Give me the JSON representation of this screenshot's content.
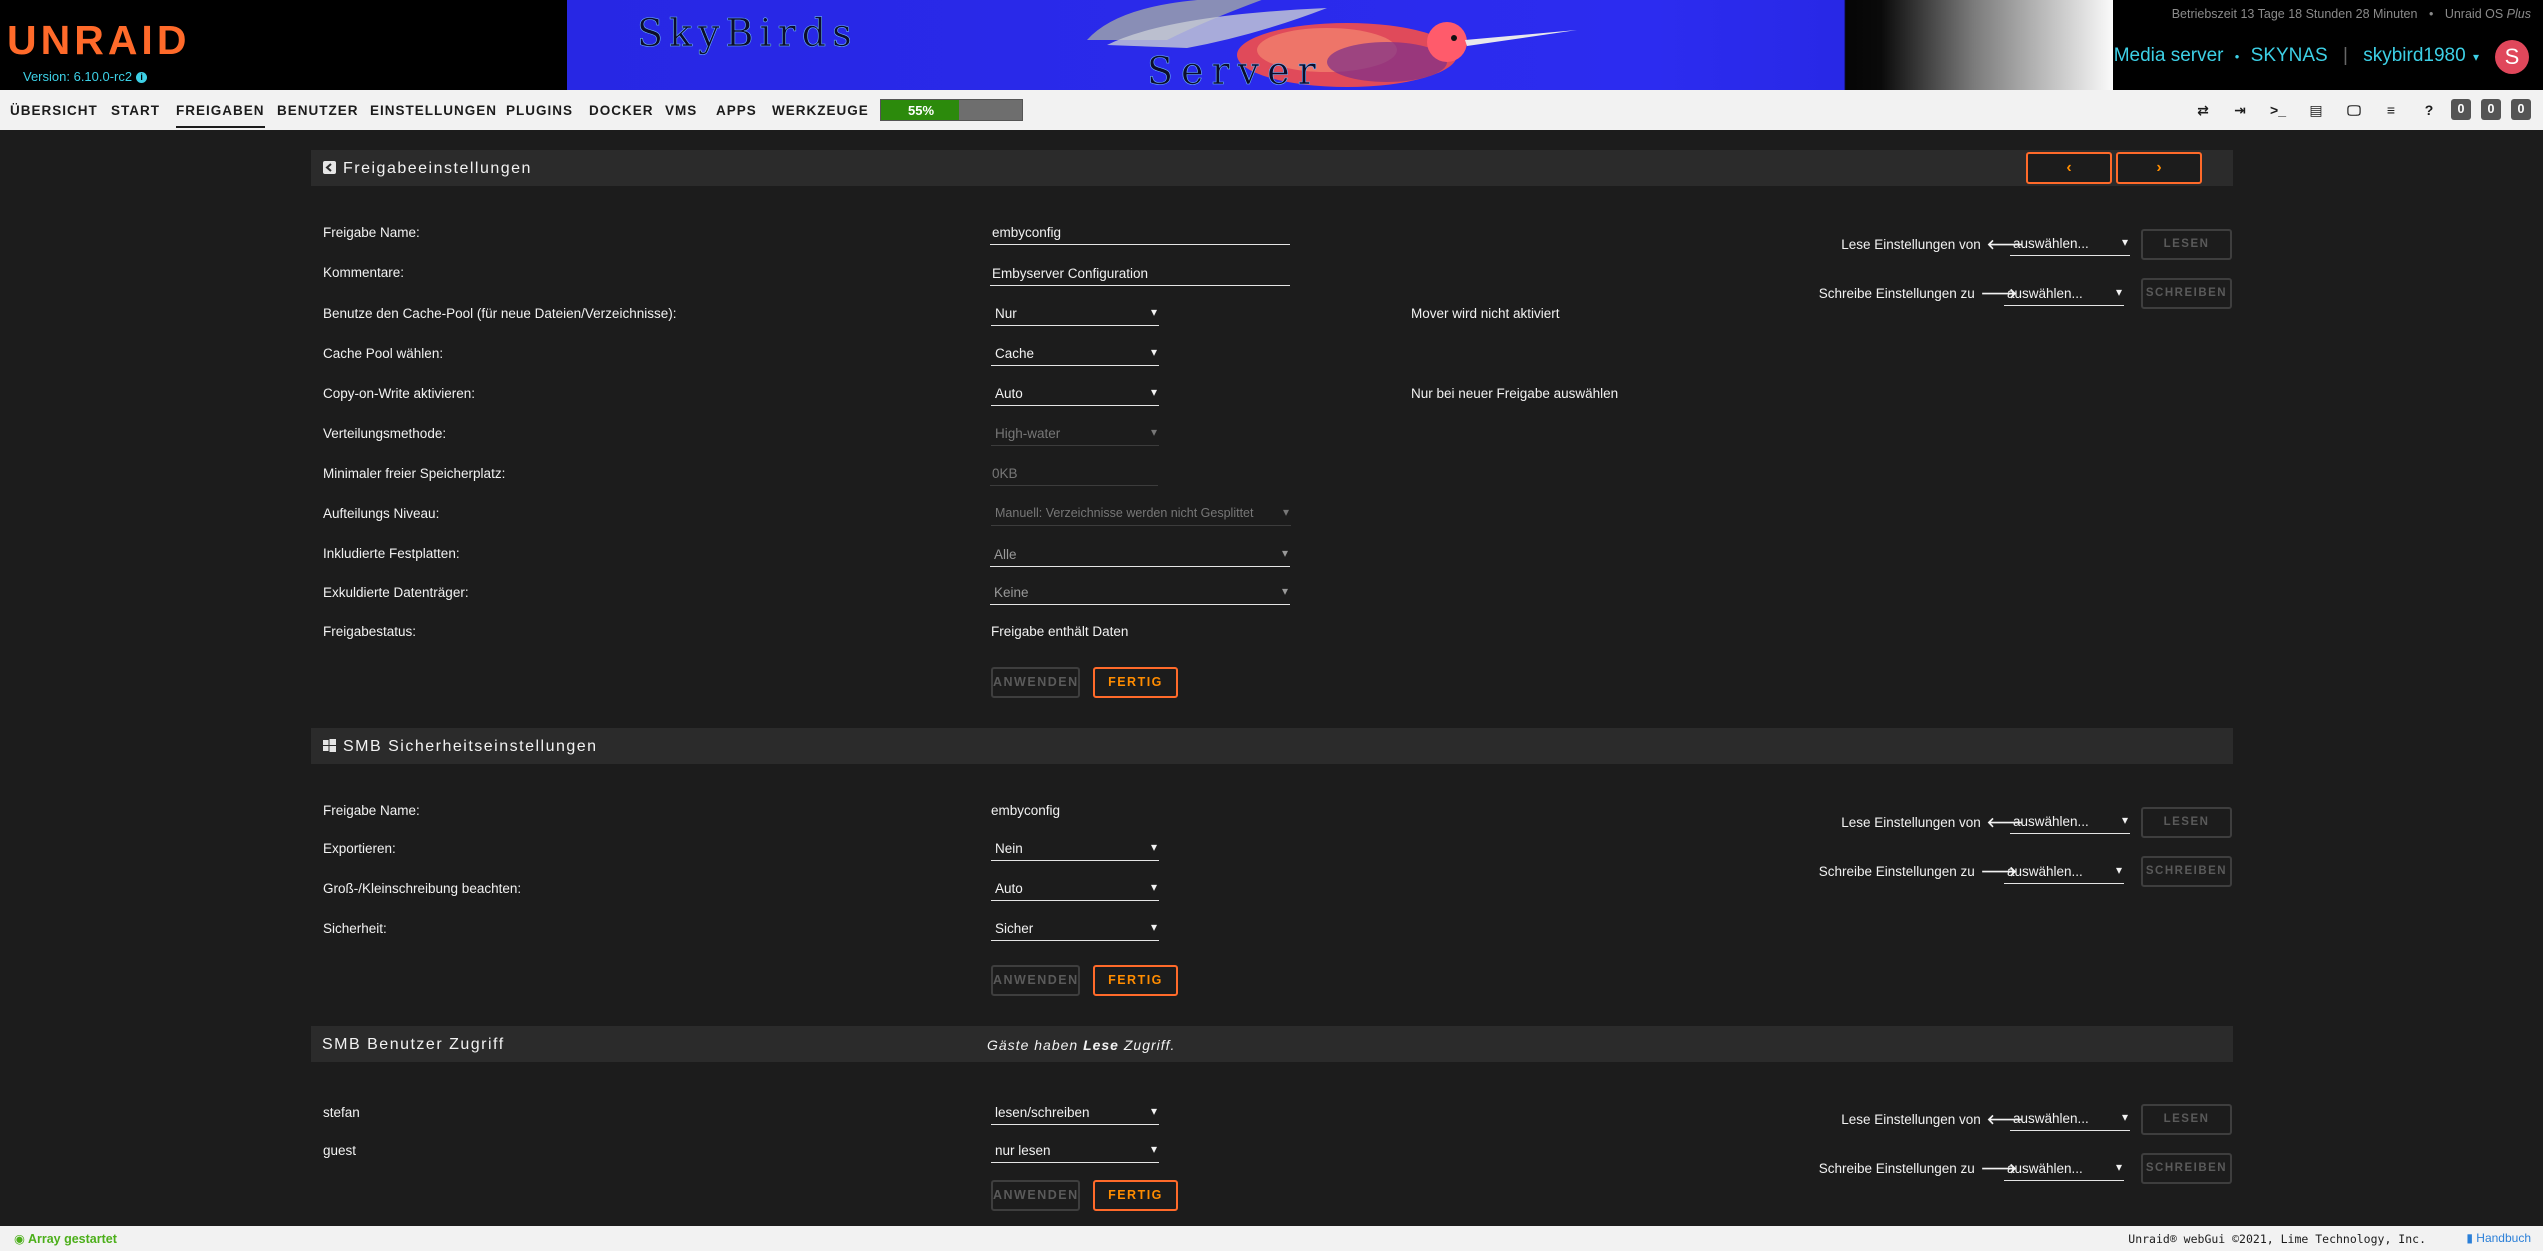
{
  "header": {
    "logo": "UNRAID",
    "version": "Version: 6.10.0-rc2",
    "banner_text_1": "SkyBirds",
    "banner_text_2": "Server",
    "uptime": "Betriebszeit 13 Tage 18 Stunden 28 Minuten",
    "uptime_sep": "•",
    "license_prefix": "Unraid OS",
    "license_tier": "Plus",
    "server_description": "Media server",
    "server_dot": "•",
    "server_name": "SKYNAS",
    "server_sep": "|",
    "username": "skybird1980",
    "user_caret": "▾",
    "avatar_letter": "S"
  },
  "nav": {
    "items": [
      "ÜBERSICHT",
      "START",
      "FREIGABEN",
      "BENUTZER",
      "EINSTELLUNGEN",
      "PLUGINS",
      "DOCKER",
      "VMS",
      "APPS",
      "WERKZEUGE"
    ],
    "active": "FREIGABEN",
    "progress_label": "55%",
    "progress_value": 0.55,
    "badges": [
      "0",
      "0",
      "0"
    ]
  },
  "share_settings": {
    "title": "Freigabeeinstellungen",
    "prev_icon": "‹",
    "next_icon": "›",
    "fields": {
      "name_label": "Freigabe Name:",
      "name_value": "embyconfig",
      "comment_label": "Kommentare:",
      "comment_value": "Embyserver Configuration",
      "cache_label": "Benutze den Cache-Pool (für neue Dateien/Verzeichnisse):",
      "cache_value": "Nur",
      "cache_note": "Mover wird nicht aktiviert",
      "pool_label": "Cache Pool wählen:",
      "pool_value": "Cache",
      "cow_label": "Copy-on-Write aktivieren:",
      "cow_value": "Auto",
      "cow_note": "Nur bei neuer Freigabe auswählen",
      "alloc_label": "Verteilungsmethode:",
      "alloc_value": "High-water",
      "minfree_label": "Minimaler freier Speicherplatz:",
      "minfree_value": "0KB",
      "split_label": "Aufteilungs Niveau:",
      "split_value": "Manuell: Verzeichnisse werden nicht Gesplittet",
      "include_label": "Inkludierte Festplatten:",
      "include_value": "Alle",
      "exclude_label": "Exkuldierte Datenträger:",
      "exclude_value": "Keine",
      "status_label": "Freigabestatus:",
      "status_value": "Freigabe enthält Daten"
    },
    "apply_label": "ANWENDEN",
    "done_label": "FERTIG",
    "read_label": "Lese Einstellungen von",
    "read_arrow": "🡐",
    "read_value": "auswählen...",
    "read_button": "LESEN",
    "write_label": "Schreibe Einstellungen zu",
    "write_arrow": "🡒",
    "write_value": "auswählen...",
    "write_button": "SCHREIBEN"
  },
  "smb_security": {
    "title": "SMB Sicherheitseinstellungen",
    "name_label": "Freigabe Name:",
    "name_value": "embyconfig",
    "export_label": "Exportieren:",
    "export_value": "Nein",
    "case_label": "Groß-/Kleinschreibung beachten:",
    "case_value": "Auto",
    "security_label": "Sicherheit:",
    "security_value": "Sicher",
    "apply_label": "ANWENDEN",
    "done_label": "FERTIG",
    "read_label": "Lese Einstellungen von",
    "read_arrow": "🡐",
    "read_value": "auswählen...",
    "read_button": "LESEN",
    "write_label": "Schreibe Einstellungen zu",
    "write_arrow": "🡒",
    "write_value": "auswählen...",
    "write_button": "SCHREIBEN"
  },
  "smb_users": {
    "title": "SMB Benutzer Zugriff",
    "guest_note_1": "Gäste haben ",
    "guest_note_bold": "Lese",
    "guest_note_2": " Zugriff.",
    "users": [
      {
        "name": "stefan",
        "access": "lesen/schreiben"
      },
      {
        "name": "guest",
        "access": "nur lesen"
      }
    ],
    "apply_label": "ANWENDEN",
    "done_label": "FERTIG",
    "read_label": "Lese Einstellungen von",
    "read_arrow": "🡐",
    "read_value": "auswählen...",
    "read_button": "LESEN",
    "write_label": "Schreibe Einstellungen zu",
    "write_arrow": "🡒",
    "write_value": "auswählen...",
    "write_button": "SCHREIBEN"
  },
  "footer": {
    "array_status": "Array gestartet",
    "copyright": "Unraid® webGui ©2021, Lime Technology, Inc.",
    "manual": "Handbuch"
  },
  "colors": {
    "accent": "#ff6a2a",
    "link": "#3dd0e6",
    "progress": "#2c8a0c",
    "status_ok": "#4caf1a"
  }
}
